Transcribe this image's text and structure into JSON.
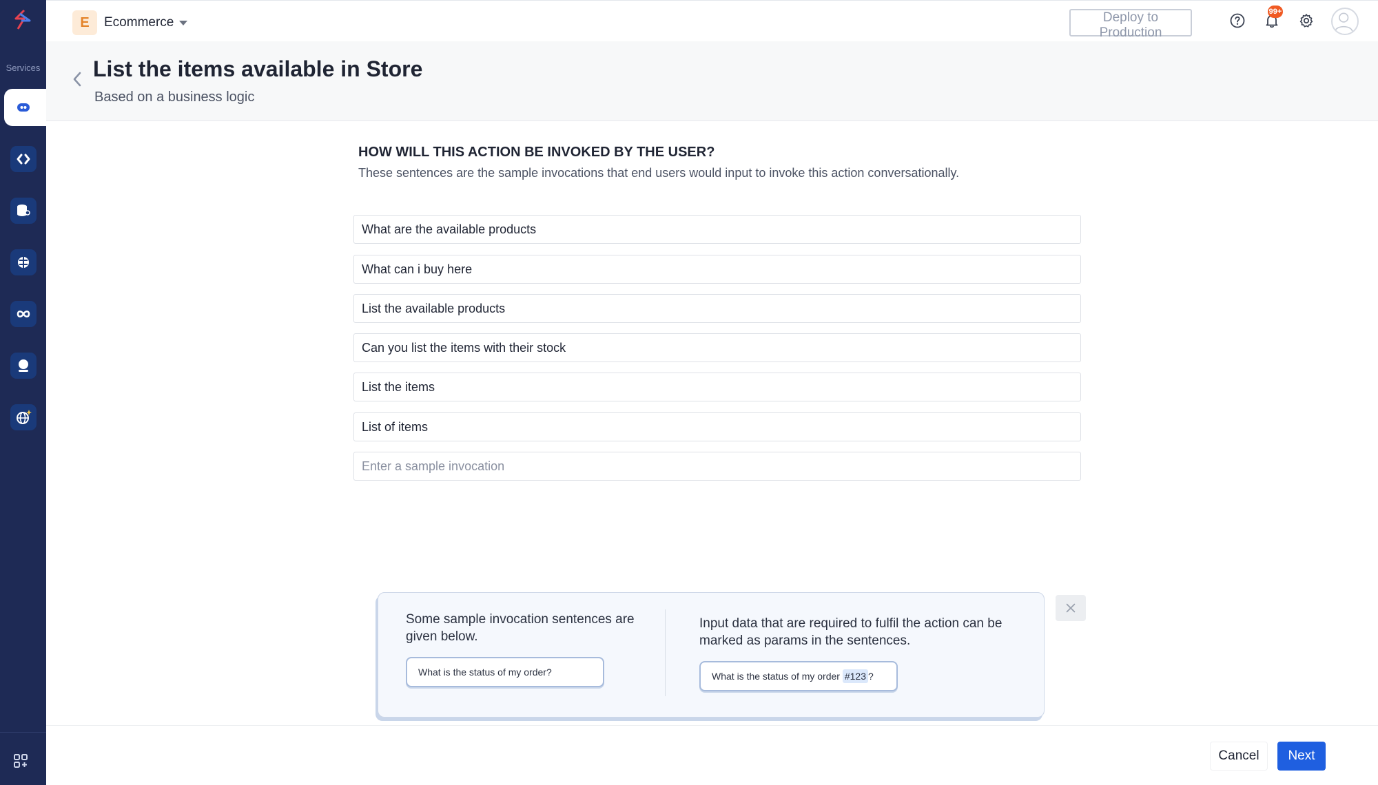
{
  "sidebar": {
    "services_label": "Services",
    "items": [
      {
        "icon": "chat-bubble-icon",
        "active": true
      },
      {
        "icon": "code-arrows-icon",
        "active": false
      },
      {
        "icon": "database-user-icon",
        "active": false
      },
      {
        "icon": "brain-icon",
        "active": false
      },
      {
        "icon": "infinity-icon",
        "active": false
      },
      {
        "icon": "user-profile-icon",
        "active": false
      },
      {
        "icon": "globe-sparkle-icon",
        "active": false
      }
    ],
    "bottom_icon": "apps-grid-icon"
  },
  "topbar": {
    "project_initial": "E",
    "project_name": "Ecommerce",
    "deploy_label": "Deploy to Production",
    "notification_count": "99+",
    "icons": [
      "help-icon",
      "bell-icon",
      "gear-icon",
      "user-avatar-icon"
    ]
  },
  "header": {
    "title": "List the items available in Store",
    "subtitle": "Based on a business logic"
  },
  "section": {
    "heading": "HOW WILL THIS ACTION BE INVOKED BY THE USER?",
    "description": "These sentences are the sample invocations that end users would input to invoke this action conversationally."
  },
  "invocations": [
    "What are the available products",
    "What can i buy here",
    "List the available products",
    "Can you list the items with their stock",
    "List the items",
    "List of items"
  ],
  "new_invocation": {
    "value": "",
    "placeholder": "Enter a sample invocation"
  },
  "hint": {
    "left_text": "Some sample invocation sentences are given below.",
    "left_example": "What is the status of my order?",
    "right_text": "Input data that are required to fulfil the action can be marked as params in the sentences.",
    "right_example_prefix": "What is the status of my order ",
    "right_example_param": "#123",
    "right_example_suffix": "?"
  },
  "footer": {
    "cancel_label": "Cancel",
    "next_label": "Next"
  },
  "colors": {
    "sidebar_bg": "#1e2a55",
    "accent": "#1f5fe0",
    "badge": "#f05a23"
  }
}
